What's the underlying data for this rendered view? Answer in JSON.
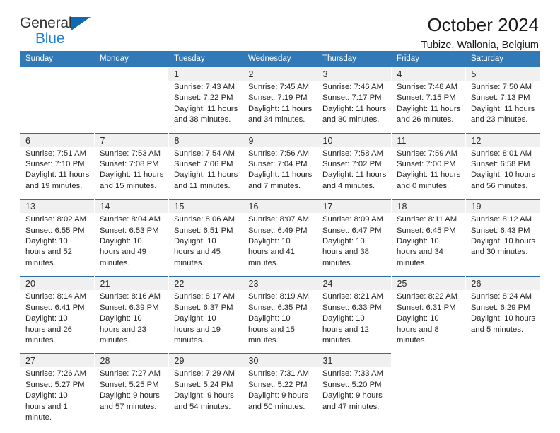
{
  "logo": {
    "word_one": "General",
    "word_two": "Blue",
    "triangle_icon": "triangle-icon",
    "color_dark": "#333333",
    "color_blue": "#1b7fd4"
  },
  "header": {
    "title": "October 2024",
    "subtitle": "Tubize, Wallonia, Belgium"
  },
  "theme": {
    "header_blue": "#3279b7",
    "rule_blue": "#2e6da4",
    "daynum_band": "#f0f0f0"
  },
  "weekdays": [
    "Sunday",
    "Monday",
    "Tuesday",
    "Wednesday",
    "Thursday",
    "Friday",
    "Saturday"
  ],
  "labels": {
    "sunrise_prefix": "Sunrise:",
    "sunset_prefix": "Sunset:",
    "daylight_prefix": "Daylight:"
  },
  "weeks": [
    [
      {
        "day": "",
        "sunrise": "",
        "sunset": "",
        "daylight": ""
      },
      {
        "day": "",
        "sunrise": "",
        "sunset": "",
        "daylight": ""
      },
      {
        "day": "1",
        "sunrise": "Sunrise: 7:43 AM",
        "sunset": "Sunset: 7:22 PM",
        "daylight": "Daylight: 11 hours and 38 minutes."
      },
      {
        "day": "2",
        "sunrise": "Sunrise: 7:45 AM",
        "sunset": "Sunset: 7:19 PM",
        "daylight": "Daylight: 11 hours and 34 minutes."
      },
      {
        "day": "3",
        "sunrise": "Sunrise: 7:46 AM",
        "sunset": "Sunset: 7:17 PM",
        "daylight": "Daylight: 11 hours and 30 minutes."
      },
      {
        "day": "4",
        "sunrise": "Sunrise: 7:48 AM",
        "sunset": "Sunset: 7:15 PM",
        "daylight": "Daylight: 11 hours and 26 minutes."
      },
      {
        "day": "5",
        "sunrise": "Sunrise: 7:50 AM",
        "sunset": "Sunset: 7:13 PM",
        "daylight": "Daylight: 11 hours and 23 minutes."
      }
    ],
    [
      {
        "day": "6",
        "sunrise": "Sunrise: 7:51 AM",
        "sunset": "Sunset: 7:10 PM",
        "daylight": "Daylight: 11 hours and 19 minutes."
      },
      {
        "day": "7",
        "sunrise": "Sunrise: 7:53 AM",
        "sunset": "Sunset: 7:08 PM",
        "daylight": "Daylight: 11 hours and 15 minutes."
      },
      {
        "day": "8",
        "sunrise": "Sunrise: 7:54 AM",
        "sunset": "Sunset: 7:06 PM",
        "daylight": "Daylight: 11 hours and 11 minutes."
      },
      {
        "day": "9",
        "sunrise": "Sunrise: 7:56 AM",
        "sunset": "Sunset: 7:04 PM",
        "daylight": "Daylight: 11 hours and 7 minutes."
      },
      {
        "day": "10",
        "sunrise": "Sunrise: 7:58 AM",
        "sunset": "Sunset: 7:02 PM",
        "daylight": "Daylight: 11 hours and 4 minutes."
      },
      {
        "day": "11",
        "sunrise": "Sunrise: 7:59 AM",
        "sunset": "Sunset: 7:00 PM",
        "daylight": "Daylight: 11 hours and 0 minutes."
      },
      {
        "day": "12",
        "sunrise": "Sunrise: 8:01 AM",
        "sunset": "Sunset: 6:58 PM",
        "daylight": "Daylight: 10 hours and 56 minutes."
      }
    ],
    [
      {
        "day": "13",
        "sunrise": "Sunrise: 8:02 AM",
        "sunset": "Sunset: 6:55 PM",
        "daylight": "Daylight: 10 hours and 52 minutes."
      },
      {
        "day": "14",
        "sunrise": "Sunrise: 8:04 AM",
        "sunset": "Sunset: 6:53 PM",
        "daylight": "Daylight: 10 hours and 49 minutes."
      },
      {
        "day": "15",
        "sunrise": "Sunrise: 8:06 AM",
        "sunset": "Sunset: 6:51 PM",
        "daylight": "Daylight: 10 hours and 45 minutes."
      },
      {
        "day": "16",
        "sunrise": "Sunrise: 8:07 AM",
        "sunset": "Sunset: 6:49 PM",
        "daylight": "Daylight: 10 hours and 41 minutes."
      },
      {
        "day": "17",
        "sunrise": "Sunrise: 8:09 AM",
        "sunset": "Sunset: 6:47 PM",
        "daylight": "Daylight: 10 hours and 38 minutes."
      },
      {
        "day": "18",
        "sunrise": "Sunrise: 8:11 AM",
        "sunset": "Sunset: 6:45 PM",
        "daylight": "Daylight: 10 hours and 34 minutes."
      },
      {
        "day": "19",
        "sunrise": "Sunrise: 8:12 AM",
        "sunset": "Sunset: 6:43 PM",
        "daylight": "Daylight: 10 hours and 30 minutes."
      }
    ],
    [
      {
        "day": "20",
        "sunrise": "Sunrise: 8:14 AM",
        "sunset": "Sunset: 6:41 PM",
        "daylight": "Daylight: 10 hours and 26 minutes."
      },
      {
        "day": "21",
        "sunrise": "Sunrise: 8:16 AM",
        "sunset": "Sunset: 6:39 PM",
        "daylight": "Daylight: 10 hours and 23 minutes."
      },
      {
        "day": "22",
        "sunrise": "Sunrise: 8:17 AM",
        "sunset": "Sunset: 6:37 PM",
        "daylight": "Daylight: 10 hours and 19 minutes."
      },
      {
        "day": "23",
        "sunrise": "Sunrise: 8:19 AM",
        "sunset": "Sunset: 6:35 PM",
        "daylight": "Daylight: 10 hours and 15 minutes."
      },
      {
        "day": "24",
        "sunrise": "Sunrise: 8:21 AM",
        "sunset": "Sunset: 6:33 PM",
        "daylight": "Daylight: 10 hours and 12 minutes."
      },
      {
        "day": "25",
        "sunrise": "Sunrise: 8:22 AM",
        "sunset": "Sunset: 6:31 PM",
        "daylight": "Daylight: 10 hours and 8 minutes."
      },
      {
        "day": "26",
        "sunrise": "Sunrise: 8:24 AM",
        "sunset": "Sunset: 6:29 PM",
        "daylight": "Daylight: 10 hours and 5 minutes."
      }
    ],
    [
      {
        "day": "27",
        "sunrise": "Sunrise: 7:26 AM",
        "sunset": "Sunset: 5:27 PM",
        "daylight": "Daylight: 10 hours and 1 minute."
      },
      {
        "day": "28",
        "sunrise": "Sunrise: 7:27 AM",
        "sunset": "Sunset: 5:25 PM",
        "daylight": "Daylight: 9 hours and 57 minutes."
      },
      {
        "day": "29",
        "sunrise": "Sunrise: 7:29 AM",
        "sunset": "Sunset: 5:24 PM",
        "daylight": "Daylight: 9 hours and 54 minutes."
      },
      {
        "day": "30",
        "sunrise": "Sunrise: 7:31 AM",
        "sunset": "Sunset: 5:22 PM",
        "daylight": "Daylight: 9 hours and 50 minutes."
      },
      {
        "day": "31",
        "sunrise": "Sunrise: 7:33 AM",
        "sunset": "Sunset: 5:20 PM",
        "daylight": "Daylight: 9 hours and 47 minutes."
      },
      {
        "day": "",
        "sunrise": "",
        "sunset": "",
        "daylight": ""
      },
      {
        "day": "",
        "sunrise": "",
        "sunset": "",
        "daylight": ""
      }
    ]
  ]
}
